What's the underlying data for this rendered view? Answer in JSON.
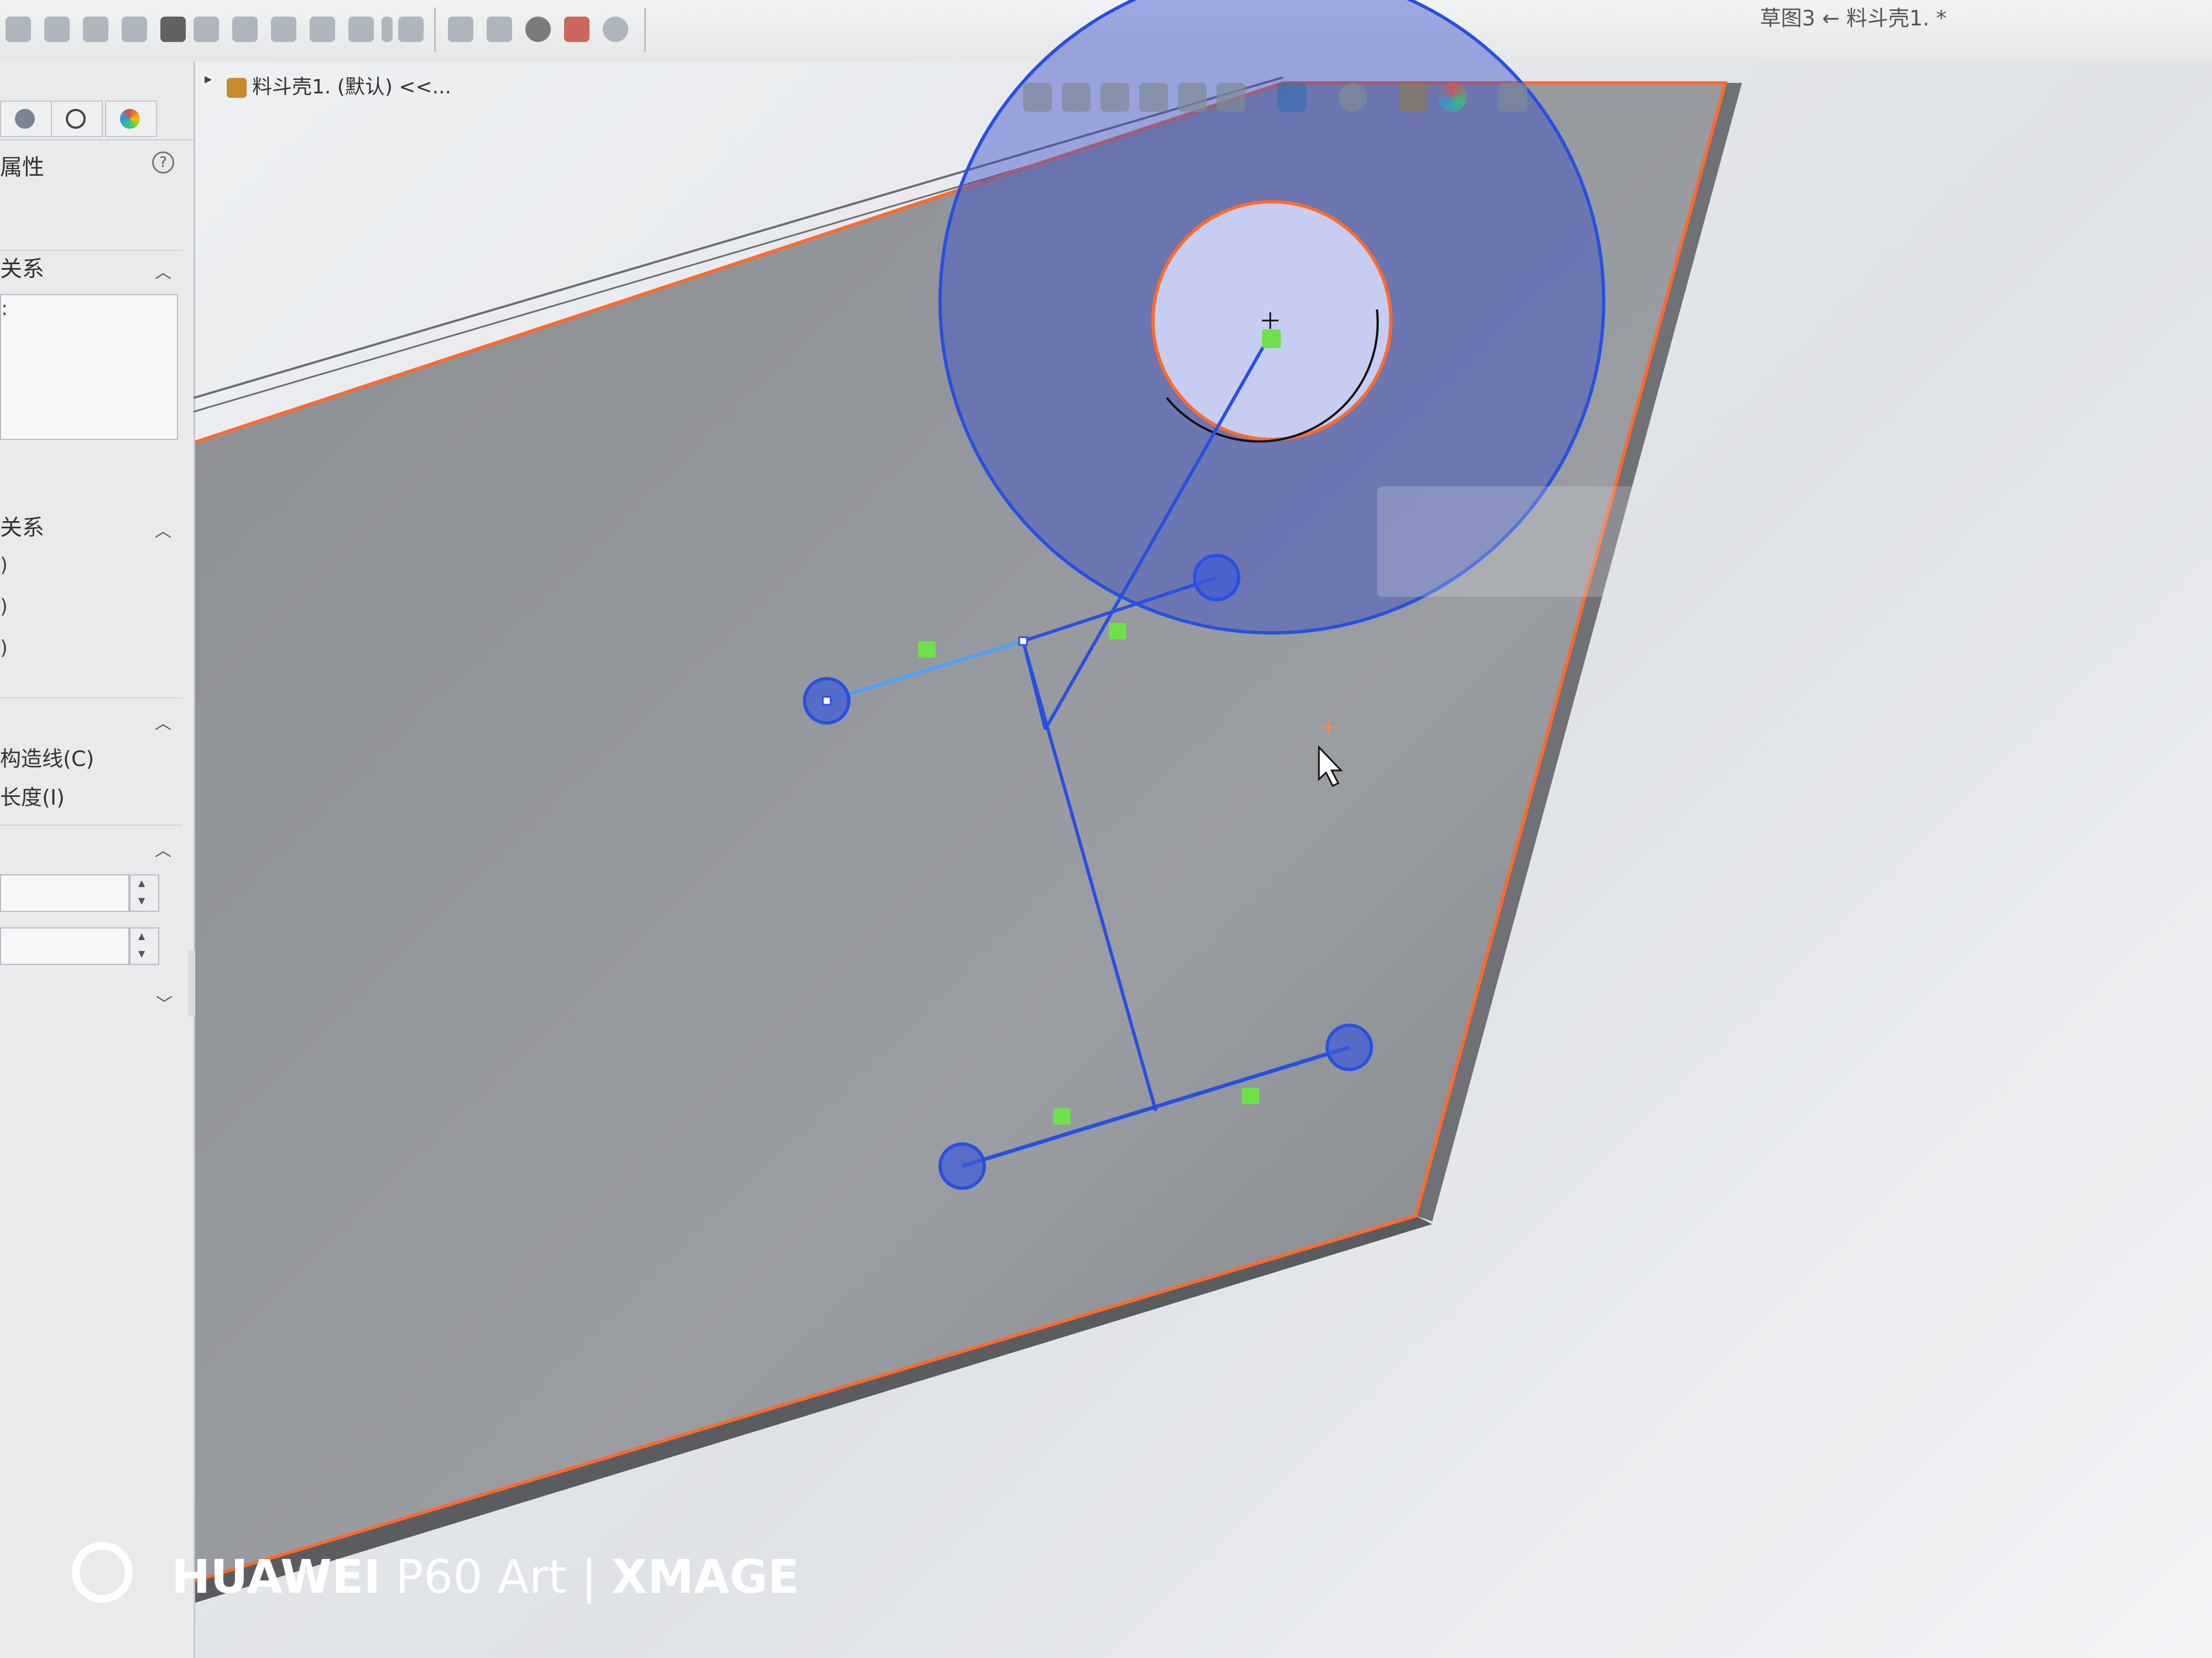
{
  "window": {
    "title": "草图3 ← 料斗壳1. *"
  },
  "toolbar": {
    "icons": [
      "smart-dimension-icon",
      "sketch-icon",
      "box-icon",
      "shaded-icon",
      "sum-icon",
      "relations-icon",
      "mirror-icon",
      "linear-pattern-icon",
      "copy-icon",
      "repair-icon",
      "dropdown-icon",
      "filter-icon",
      "display-relations-icon",
      "rebuild-icon",
      "check-icon",
      "color-icon",
      "settings-icon"
    ]
  },
  "panel": {
    "tabs": [
      "feature-manager-tab",
      "property-manager-tab",
      "configuration-tab",
      "appearance-tab"
    ],
    "title": "属性",
    "help": "?",
    "sections": {
      "existing_relations": {
        "label": "关系",
        "items": [
          ":"
        ]
      },
      "add_relations": {
        "label": "关系",
        "items": [
          ")",
          ")",
          ")"
        ]
      },
      "options": {
        "label": "",
        "items": [
          "构造线(C)",
          "长度(I)"
        ]
      },
      "parameters": {
        "label": "",
        "fields": [
          "",
          ""
        ]
      }
    }
  },
  "graphics": {
    "breadcrumb": "料斗壳1. (默认) <<...",
    "hud_icons": [
      "zoom-fit-icon",
      "zoom-area-icon",
      "previous-view-icon",
      "section-view-icon",
      "dynamic-annotation-icon",
      "view-orientation-icon",
      "display-style-icon",
      "hide-show-icon",
      "edit-appearance-icon",
      "apply-scene-icon",
      "view-settings-icon"
    ],
    "colors": {
      "sketch_blue": "#2850e0",
      "edge_orange": "#ff6a2a",
      "relation_green": "#6ee04a",
      "face_gray": "#8e9196"
    }
  },
  "watermark": {
    "brand": "HUAWEI",
    "model": "P60 Art",
    "divider": "|",
    "tag": "XMAGE"
  }
}
